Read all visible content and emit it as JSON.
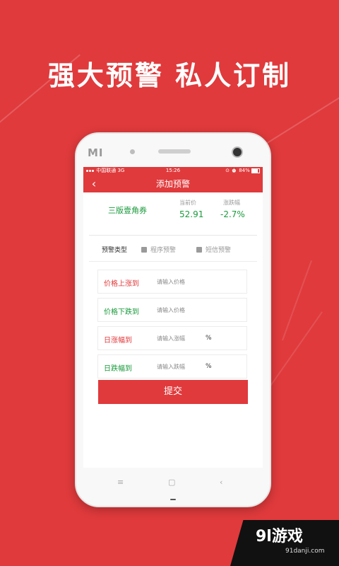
{
  "headline": "强大预警 私人订制",
  "device": {
    "logo": "MI"
  },
  "status": {
    "carrier": "中国联通",
    "network": "3G",
    "time": "15:26",
    "icons": "⊙ ⏰",
    "battery": "84%"
  },
  "header": {
    "back_icon": "‹",
    "title": "添加预警"
  },
  "quote": {
    "name": "三版壹角券",
    "price_label": "当前价",
    "price": "52.91",
    "change_label": "涨跌幅",
    "change": "-2.7%"
  },
  "alert_type": {
    "label": "预警类型",
    "options": [
      "程序预警",
      "短信预警"
    ]
  },
  "fields": [
    {
      "label": "价格上涨到",
      "placeholder": "请输入价格",
      "unit": "",
      "color": "#e03a3c"
    },
    {
      "label": "价格下跌到",
      "placeholder": "请输入价格",
      "unit": "",
      "color": "#1a9a3c"
    },
    {
      "label": "日涨幅到",
      "placeholder": "请输入涨幅",
      "unit": "%",
      "color": "#e03a3c"
    },
    {
      "label": "日跌幅到",
      "placeholder": "请输入跌幅",
      "unit": "%",
      "color": "#1a9a3c"
    }
  ],
  "submit_label": "提交",
  "navkeys": {
    "menu": "≡",
    "home": "▢",
    "back": "‹"
  },
  "watermark": {
    "brand": "9l游戏",
    "url": "91danji.com"
  },
  "colors": {
    "accent": "#e03a3c",
    "green": "#1a9a3c"
  }
}
